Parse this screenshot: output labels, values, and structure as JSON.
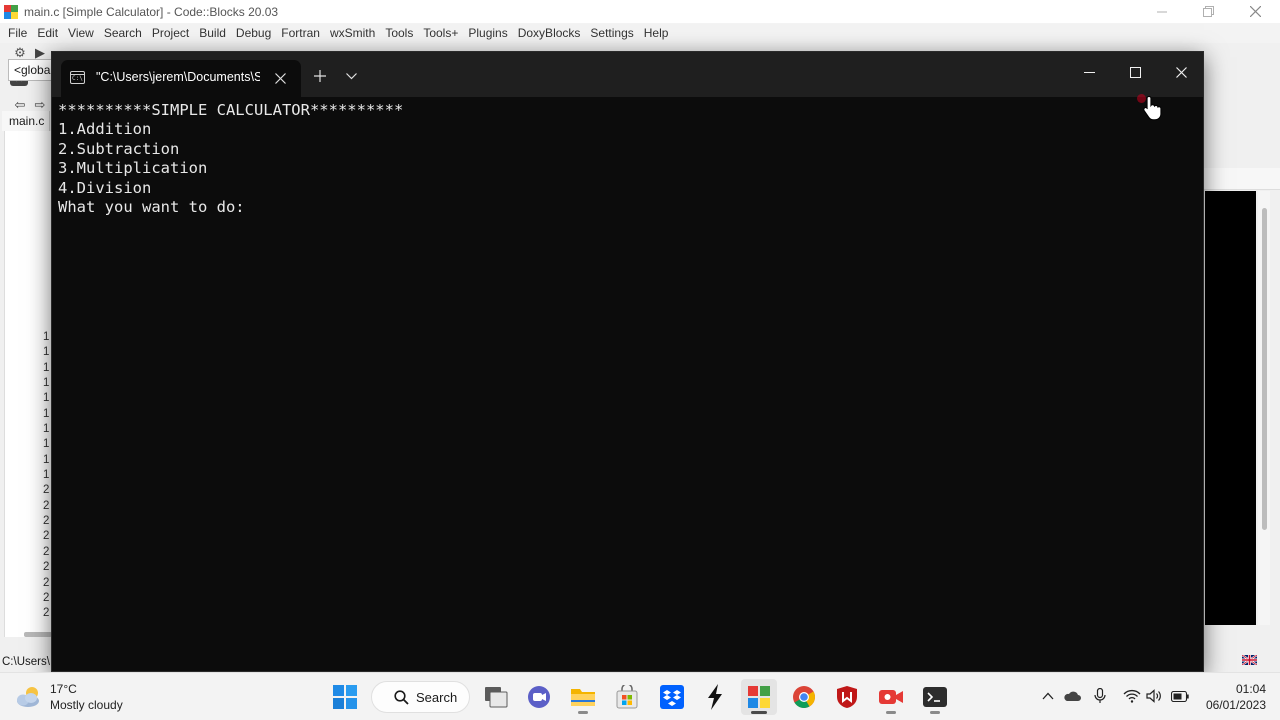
{
  "codeblocks": {
    "title": "main.c [Simple Calculator] - Code::Blocks 20.03",
    "menu": [
      "File",
      "Edit",
      "View",
      "Search",
      "Project",
      "Build",
      "Debug",
      "Fortran",
      "wxSmith",
      "Tools",
      "Tools+",
      "Plugins",
      "DoxyBlocks",
      "Settings",
      "Help"
    ],
    "scope_box": "<global>",
    "file_tab": "main.c",
    "line_numbers": [
      "1",
      "1",
      "1",
      "1",
      "1",
      "1",
      "1",
      "1",
      "1",
      "1",
      "2",
      "2",
      "2",
      "2",
      "2",
      "2",
      "2",
      "2",
      "2"
    ],
    "status_path": "C:\\Users\\"
  },
  "terminal": {
    "tab_title": "\"C:\\Users\\jerem\\Documents\\Simple Calculator\\bin\\Debug\\Simple Calculator.exe\"",
    "output_lines": [
      "**********SIMPLE CALCULATOR**********",
      "1.Addition",
      "2.Subtraction",
      "3.Multiplication",
      "4.Division",
      "What you want to do:"
    ]
  },
  "taskbar": {
    "weather": {
      "temperature": "17°C",
      "description": "Mostly cloudy"
    },
    "search_label": "Search",
    "apps": [
      "Start",
      "Task View",
      "Teams Chat",
      "File Explorer",
      "Microsoft Store",
      "Dropbox",
      "Winamp",
      "Code::Blocks",
      "Google Chrome",
      "McAfee",
      "Screen Recorder",
      "Terminal"
    ],
    "clock": {
      "time": "01:04",
      "date": "06/01/2023"
    }
  },
  "colors": {
    "terminal_bg": "#0c0c0c",
    "terminal_titlebar": "#1f1f1f",
    "terminal_text": "#e8e8e8",
    "taskbar_bg": "#f3f3f3"
  }
}
